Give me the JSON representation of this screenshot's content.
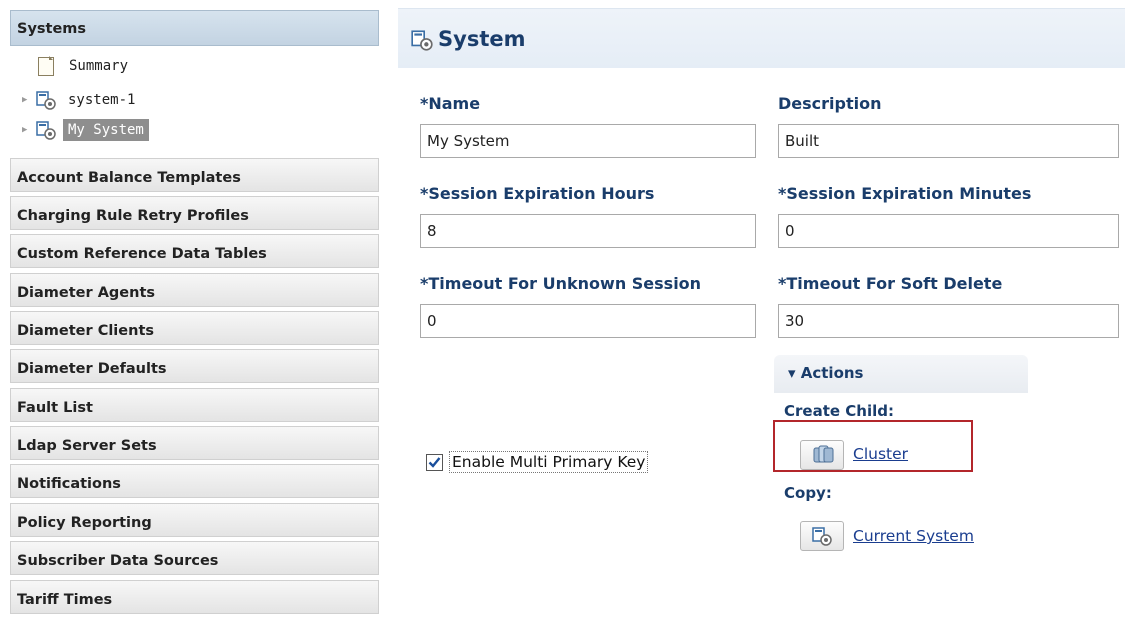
{
  "sidebar": {
    "systems_header": "Systems",
    "tree": {
      "summary": "Summary",
      "system1": "system-1",
      "my_system": "My System"
    },
    "sections": [
      "Account Balance Templates",
      "Charging Rule Retry Profiles",
      "Custom Reference Data Tables",
      "Diameter Agents",
      "Diameter Clients",
      "Diameter Defaults",
      "Fault List",
      "Ldap Server Sets",
      "Notifications",
      "Policy Reporting",
      "Subscriber Data Sources",
      "Tariff Times"
    ]
  },
  "main": {
    "title": "System",
    "fields": {
      "name": {
        "label": "*Name",
        "value": "My System"
      },
      "description": {
        "label": "Description",
        "value": "Built"
      },
      "session_hours": {
        "label": "*Session Expiration Hours",
        "value": "8"
      },
      "session_minutes": {
        "label": "*Session Expiration Minutes",
        "value": "0"
      },
      "timeout_unknown": {
        "label": "*Timeout For Unknown Session",
        "value": "0"
      },
      "timeout_soft_delete": {
        "label": "*Timeout For Soft Delete",
        "value": "30"
      }
    },
    "checkbox": {
      "label": "Enable Multi Primary Key",
      "checked": true
    },
    "actions": {
      "header": "▾ Actions",
      "create_child_label": "Create Child:",
      "cluster_link": "Cluster",
      "copy_label": "Copy:",
      "current_system_link": "Current System"
    }
  },
  "colors": {
    "label_blue": "#1a3d6b",
    "link_blue": "#1a3d8f",
    "highlight_red": "#b3262b",
    "selected_gray": "#8e8e8e"
  },
  "icons": [
    "document-icon",
    "system-icon",
    "cluster-icon",
    "tree-expand-icon",
    "checkmark-icon"
  ]
}
